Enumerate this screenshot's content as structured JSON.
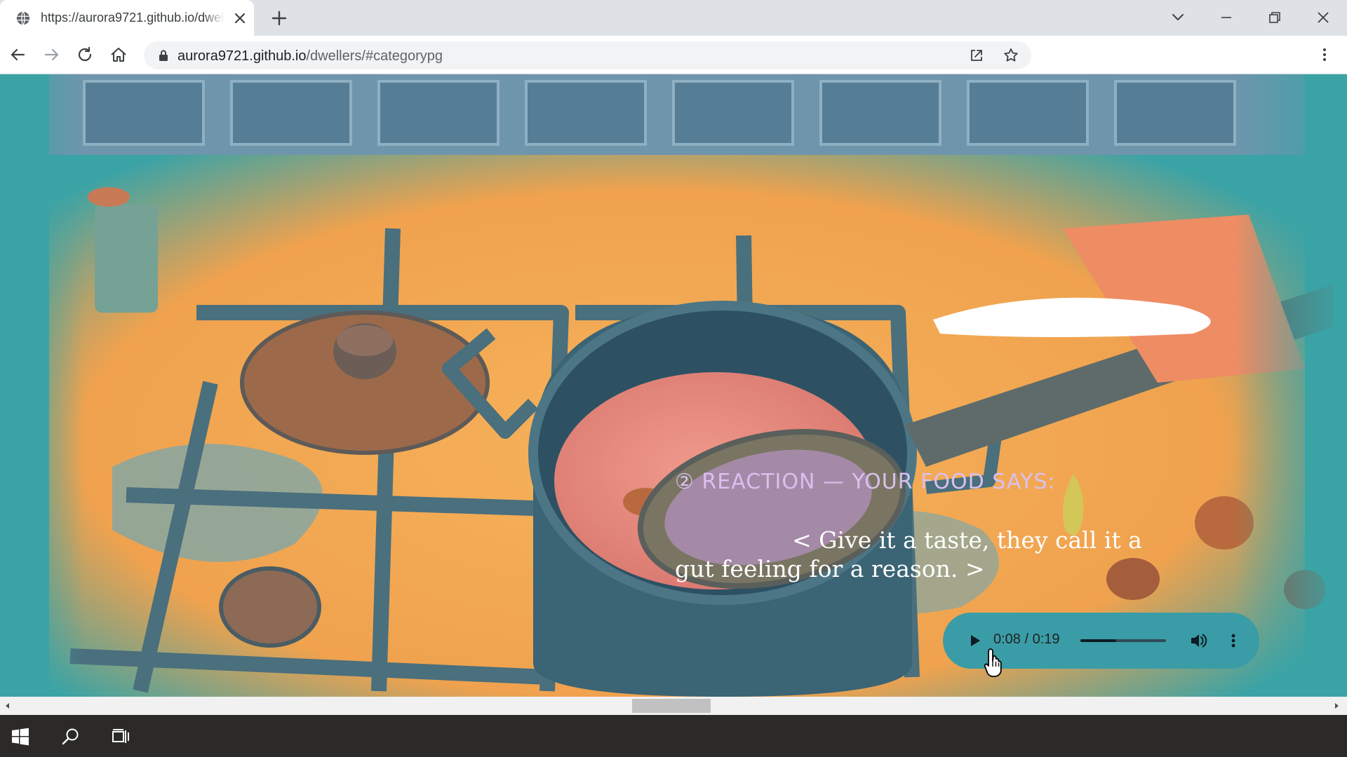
{
  "browser": {
    "tab_title": "https://aurora9721.github.io/dwellers/#categorypg",
    "url_domain": "aurora9721.github.io",
    "url_path": "/dwellers/#categorypg"
  },
  "page": {
    "reaction_label": "② REACTION — YOUR FOOD SAYS:",
    "reaction_quote": "< Give it a taste, they call it a gut feeling for a reason. >",
    "colors": {
      "backdrop": "#3aa3a6",
      "counter": "#f2a44e",
      "grate": "#3f6b78",
      "pot": "#3b6474",
      "soup": "#e7878a",
      "label": "#d9c0f0"
    }
  },
  "audio_player": {
    "time": "0:08 / 0:19",
    "progress": 0.42,
    "icons": [
      "play-icon",
      "volume-icon",
      "more-vert-icon"
    ]
  },
  "taskbar": {
    "icons": [
      "windows-start-icon",
      "search-icon",
      "task-view-icon"
    ]
  }
}
